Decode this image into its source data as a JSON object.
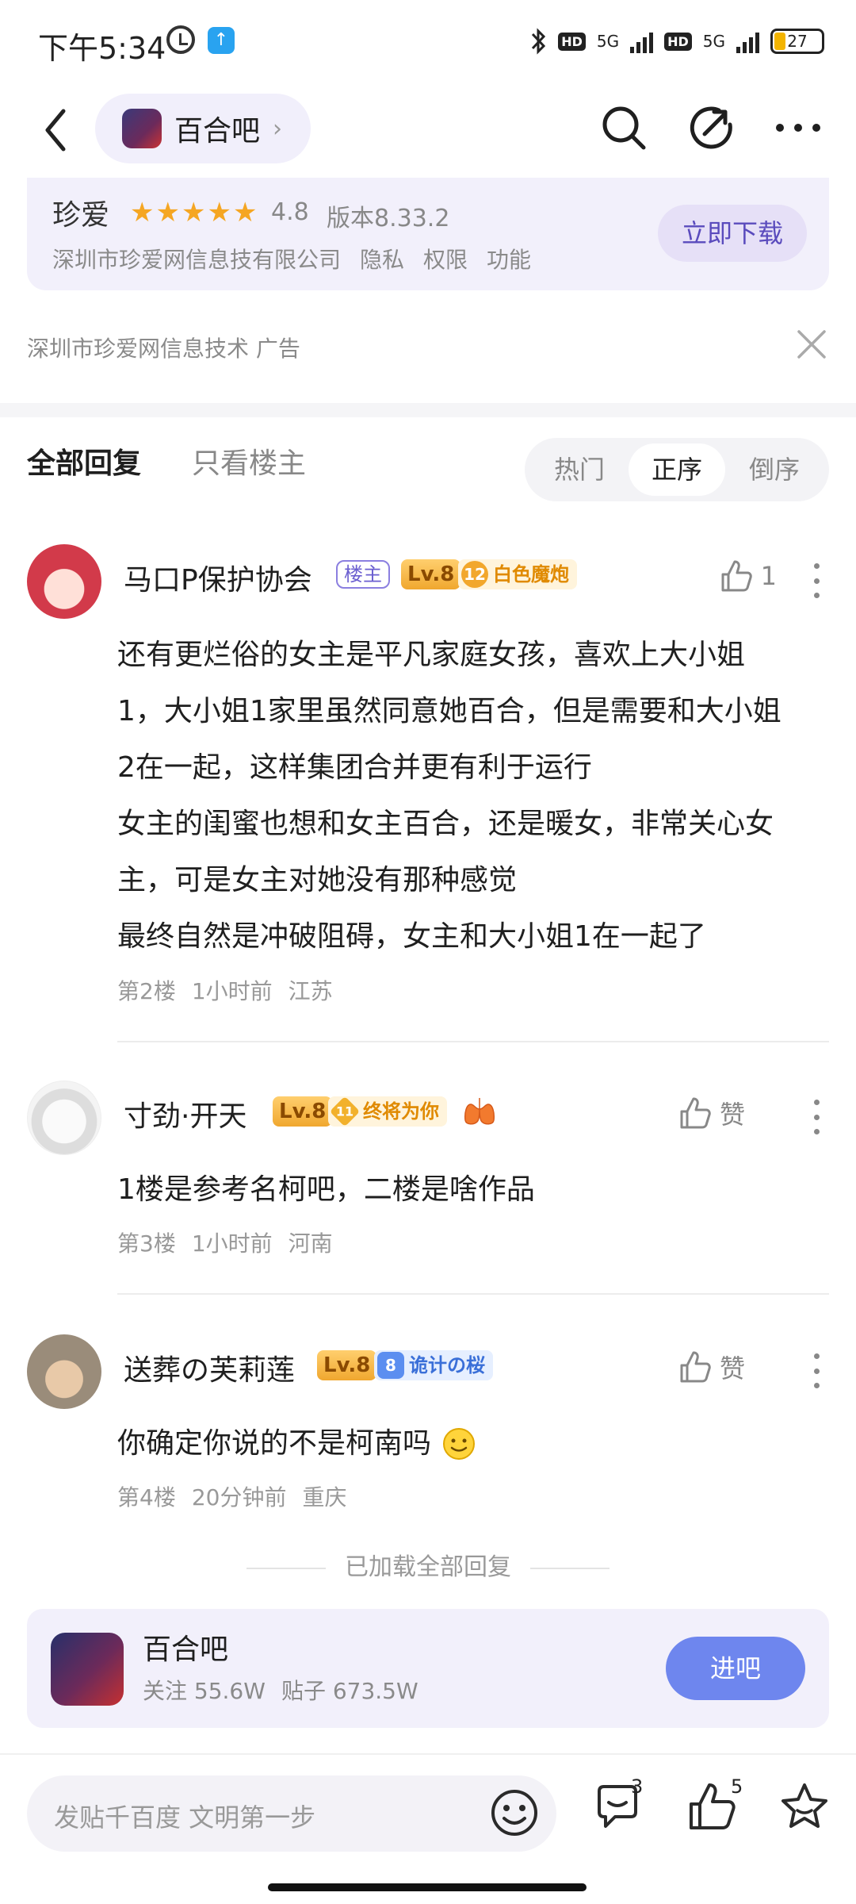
{
  "status_bar": {
    "time": "下午5:34",
    "hd1": "HD",
    "net1": "5G",
    "hd2": "HD",
    "net2": "5G",
    "battery": "27"
  },
  "nav": {
    "forum_name": "百合吧",
    "chevron": "›"
  },
  "ad": {
    "app_name": "珍爱",
    "rating": "4.8",
    "version": "版本8.33.2",
    "company": "深圳市珍爱网信息技有限公司",
    "links": [
      "隐私",
      "权限",
      "功能"
    ],
    "download_label": "立即下载",
    "source": "深圳市珍爱网信息技术  广告"
  },
  "tabs": {
    "all": "全部回复",
    "op_only": "只看楼主",
    "sort": [
      "热门",
      "正序",
      "倒序"
    ]
  },
  "posts": [
    {
      "username": "马口P保护协会",
      "op_badge": "楼主",
      "level": "Lv.8",
      "title_num": "12",
      "title": "白色魔炮",
      "likes": "1",
      "lines": [
        "还有更烂俗的女主是平凡家庭女孩，喜欢上大小姐",
        "1，大小姐1家里虽然同意她百合，但是需要和大小姐",
        "2在一起，这样集团合并更有利于运行",
        "女主的闺蜜也想和女主百合，还是暖女，非常关心女",
        "主，可是女主对她没有那种感觉",
        "最终自然是冲破阻碍，女主和大小姐1在一起了"
      ],
      "floor": "第2楼",
      "time": "1小时前",
      "location": "江苏"
    },
    {
      "username": "寸劲·开天",
      "level": "Lv.8",
      "title_num": "11",
      "title": "终将为你",
      "likes": "赞",
      "lines": [
        "1楼是参考名柯吧，二楼是啥作品"
      ],
      "floor": "第3楼",
      "time": "1小时前",
      "location": "河南"
    },
    {
      "username": "送葬の芙莉莲",
      "level": "Lv.8",
      "title_num": "8",
      "title": "诡计の桜",
      "likes": "赞",
      "lines": [
        "你确定你说的不是柯南吗"
      ],
      "floor": "第4楼",
      "time": "20分钟前",
      "location": "重庆"
    }
  ],
  "loaded_text": "已加载全部回复",
  "forum_card": {
    "name": "百合吧",
    "follow": "关注 55.6W",
    "posts": "贴子 673.5W",
    "enter_label": "进吧"
  },
  "bottom": {
    "placeholder": "发贴千百度 文明第一步",
    "comment_count": "3",
    "like_count": "5"
  },
  "colors": {
    "accent": "#6e86ee",
    "ad_bg": "#f2f0fb",
    "star": "#f5a623"
  }
}
